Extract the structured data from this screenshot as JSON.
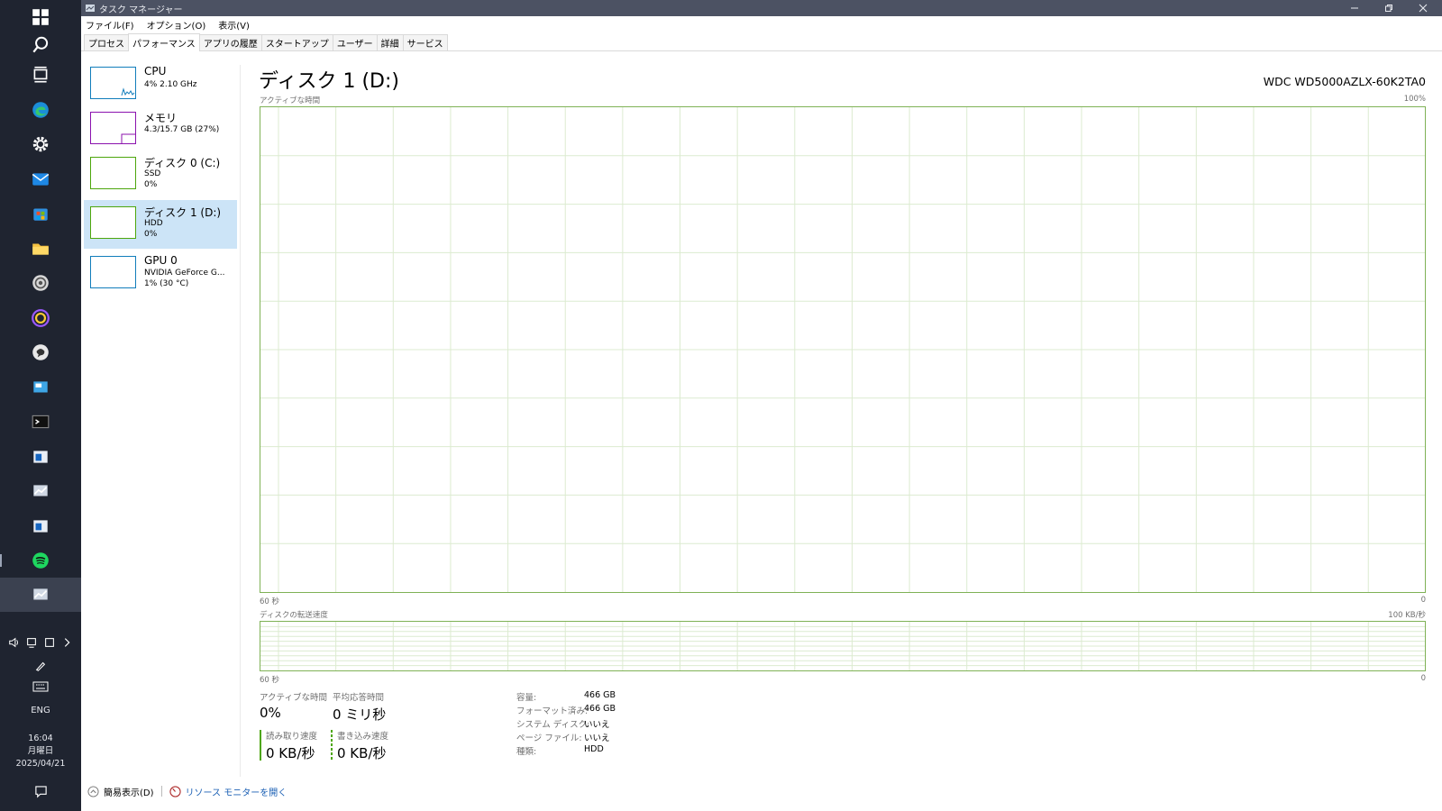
{
  "window": {
    "title": "タスク マネージャー"
  },
  "menu": [
    "ファイル(F)",
    "オプション(O)",
    "表示(V)"
  ],
  "tabs": [
    {
      "label": "プロセス",
      "active": false
    },
    {
      "label": "パフォーマンス",
      "active": true
    },
    {
      "label": "アプリの履歴",
      "active": false
    },
    {
      "label": "スタートアップ",
      "active": false
    },
    {
      "label": "ユーザー",
      "active": false
    },
    {
      "label": "詳細",
      "active": false
    },
    {
      "label": "サービス",
      "active": false
    }
  ],
  "sidebar": {
    "items": [
      {
        "title": "CPU",
        "line1": "4% 2.10 GHz",
        "line2": "",
        "color": "#117dbb",
        "selected": false
      },
      {
        "title": "メモリ",
        "line1": "4.3/15.7 GB (27%)",
        "line2": "",
        "color": "#8b12ae",
        "selected": false
      },
      {
        "title": "ディスク 0 (C:)",
        "line1": "SSD",
        "line2": "0%",
        "color": "#4da60c",
        "selected": false
      },
      {
        "title": "ディスク 1 (D:)",
        "line1": "HDD",
        "line2": "0%",
        "color": "#4da60c",
        "selected": true
      },
      {
        "title": "GPU 0",
        "line1": "NVIDIA GeForce G...",
        "line2": "1% (30 °C)",
        "color": "#117dbb",
        "selected": false
      }
    ]
  },
  "main": {
    "title": "ディスク 1 (D:)",
    "device": "WDC WD5000AZLX-60K2TA0",
    "graph1": {
      "label": "アクティブな時間",
      "max": "100%",
      "left_bottom": "60 秒",
      "right_bottom": "0"
    },
    "graph2": {
      "label": "ディスクの転送速度",
      "max": "100 KB/秒",
      "left_bottom": "60 秒",
      "right_bottom": "0"
    },
    "stats": {
      "active_time_label": "アクティブな時間",
      "active_time_value": "0%",
      "avg_response_label": "平均応答時間",
      "avg_response_value": "0 ミリ秒",
      "read_label": "読み取り速度",
      "read_value": "0 KB/秒",
      "write_label": "書き込み速度",
      "write_value": "0 KB/秒"
    },
    "info": [
      {
        "label": "容量:",
        "value": "466 GB"
      },
      {
        "label": "フォーマット済み:",
        "value": "466 GB"
      },
      {
        "label": "システム ディスク:",
        "value": "いいえ"
      },
      {
        "label": "ページ ファイル:",
        "value": "いいえ"
      },
      {
        "label": "種類:",
        "value": "HDD"
      }
    ]
  },
  "footer": {
    "compact_label": "簡易表示(D)",
    "resmon_label": "リソース モニターを開く"
  },
  "taskbar": {
    "lang": "ENG",
    "time": "16:04",
    "day": "月曜日",
    "date": "2025/04/21"
  },
  "colors": {
    "disk_accent": "#4da60c",
    "selection": "#cce4f7",
    "taskbar_bg": "#1f2430"
  }
}
